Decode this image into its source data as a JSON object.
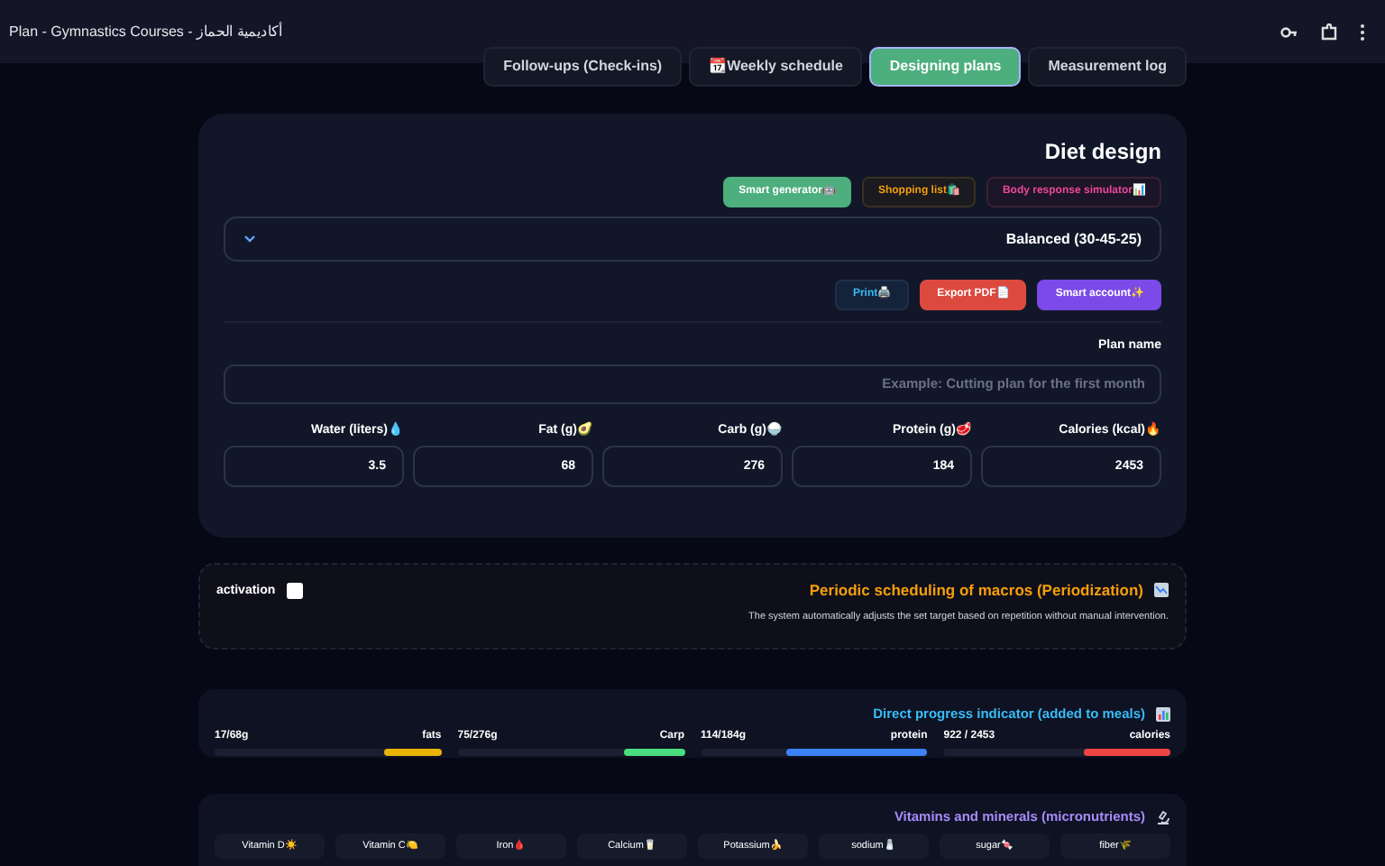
{
  "window": {
    "title": "Plan - Gymnastics Courses - أكاديمية الحماز"
  },
  "tabs": [
    {
      "label": "Follow-ups (Check-ins)",
      "selected": false
    },
    {
      "label": "📆Weekly schedule",
      "selected": false
    },
    {
      "label": "Designing plans",
      "selected": true
    },
    {
      "label": "Measurement log",
      "selected": false
    }
  ],
  "diet": {
    "title": "Diet design",
    "tools": [
      {
        "label": "Smart generator🤖",
        "kind": "green"
      },
      {
        "label": "Shopping list🛍️",
        "kind": "amber"
      },
      {
        "label": "Body response simulator📊",
        "kind": "pink"
      }
    ],
    "preset": "Balanced (30-45-25)",
    "actions": [
      {
        "label": "Print🖨️",
        "kind": "print"
      },
      {
        "label": "Export PDF📄",
        "kind": "pdf"
      },
      {
        "label": "Smart account✨",
        "kind": "smart"
      }
    ],
    "plan_name": {
      "label": "Plan name",
      "placeholder": "Example: Cutting plan for the first month"
    },
    "macros": [
      {
        "label": "Water (liters)💧",
        "value": "3.5"
      },
      {
        "label": "Fat (g)🥑",
        "value": "68"
      },
      {
        "label": "Carb (g)🍚",
        "value": "276"
      },
      {
        "label": "Protein (g)🥩",
        "value": "184"
      },
      {
        "label": "Calories (kcal)🔥",
        "value": "2453"
      }
    ]
  },
  "periodization": {
    "title": "Periodic scheduling of macros (Periodization)",
    "description": "The system automatically adjusts the set target based on repetition without manual intervention.",
    "toggle_label": "activation",
    "checked": false
  },
  "progress": {
    "title": "Direct progress indicator (added to meals)",
    "bars": [
      {
        "reading": "17/68g",
        "label": "fats",
        "level": 0.25,
        "color": "#eab308"
      },
      {
        "reading": "75/276g",
        "label": "Carp",
        "level": 0.27,
        "color": "#4ade80"
      },
      {
        "reading": "114/184g",
        "label": "protein",
        "level": 0.62,
        "color": "#3b82f6"
      },
      {
        "reading": "922 / 2453",
        "label": "calories",
        "level": 0.38,
        "color": "#ef4444"
      }
    ]
  },
  "micronutrients": {
    "title": "Vitamins and minerals (micronutrients)",
    "items": [
      "Vitamin D☀️",
      "Vitamin C🍋",
      "Iron🩸",
      "Calcium🥛",
      "Potassium🍌",
      "sodium🧂",
      "sugar🍬",
      "fiber🌾"
    ]
  }
}
